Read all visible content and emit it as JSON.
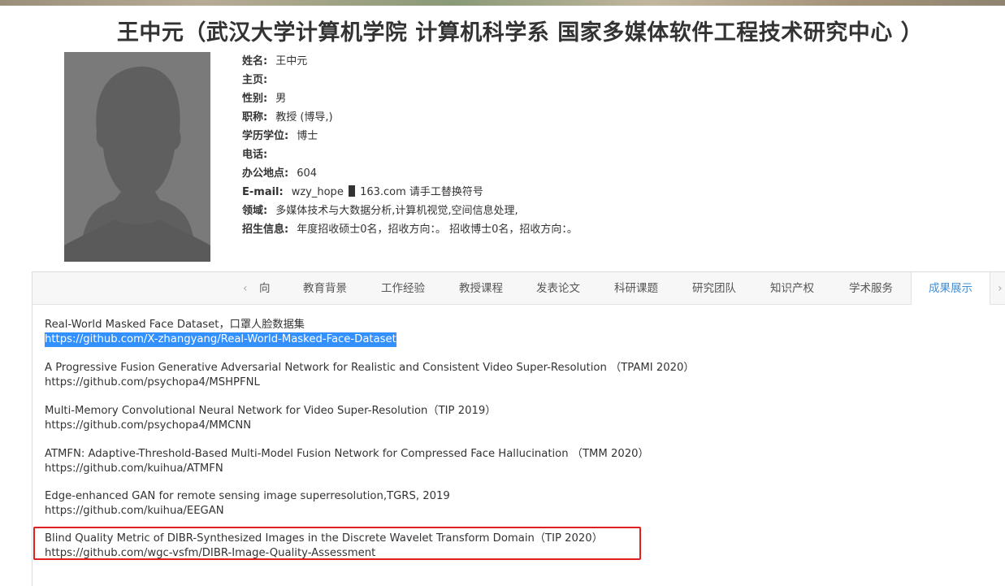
{
  "page": {
    "title": "王中元（武汉大学计算机学院 计算机科学系 国家多媒体软件工程技术研究中心 ）"
  },
  "profile": {
    "rows": [
      {
        "label": "姓名:",
        "value": "王中元"
      },
      {
        "label": "主页:",
        "value": ""
      },
      {
        "label": "性别:",
        "value": "男"
      },
      {
        "label": "职称:",
        "value": "教授 (博导,)"
      },
      {
        "label": "学历学位:",
        "value": "博士"
      },
      {
        "label": "电话:",
        "value": ""
      },
      {
        "label": "办公地点:",
        "value": "604"
      },
      {
        "label": "E-mail:",
        "value_before": "wzy_hope",
        "value_after": "163.com 请手工替换符号"
      },
      {
        "label": "领域:",
        "value": "多媒体技术与大数据分析,计算机视觉,空间信息处理,"
      },
      {
        "label": "招生信息:",
        "value": "年度招收硕士0名，招收方向：。 招收博士0名，招收方向：。"
      }
    ]
  },
  "tabs": {
    "prev_arrow": "‹",
    "items": [
      {
        "label": "向"
      },
      {
        "label": "教育背景"
      },
      {
        "label": "工作经验"
      },
      {
        "label": "教授课程"
      },
      {
        "label": "发表论文"
      },
      {
        "label": "科研课题"
      },
      {
        "label": "研究团队"
      },
      {
        "label": "知识产权"
      },
      {
        "label": "学术服务"
      },
      {
        "label": "成果展示"
      }
    ],
    "active": "成果展示",
    "next_arrow": "›"
  },
  "entries": [
    {
      "title": "Real-World Masked Face Dataset，口罩人脸数据集",
      "url": "https://github.com/X-zhangyang/Real-World-Masked-Face-Dataset",
      "selected": true
    },
    {
      "title": "A Progressive Fusion Generative Adversarial Network for Realistic and Consistent Video Super-Resolution （TPAMI 2020）",
      "url": "https://github.com/psychopa4/MSHPFNL"
    },
    {
      "title": "Multi-Memory Convolutional Neural Network for Video Super-Resolution（TIP 2019）",
      "url": "https://github.com/psychopa4/MMCNN"
    },
    {
      "title": "ATMFN: Adaptive-Threshold-Based Multi-Model Fusion Network for Compressed Face Hallucination （TMM 2020）",
      "url": "https://github.com/kuihua/ATMFN"
    },
    {
      "title": "Edge-enhanced GAN for remote sensing image superresolution,TGRS, 2019",
      "url": "https://github.com/kuihua/EEGAN"
    },
    {
      "title": "Blind Quality Metric of DIBR-Synthesized Images in the Discrete Wavelet Transform Domain（TIP 2020）",
      "url": "https://github.com/wgc-vsfm/DIBR-Image-Quality-Assessment",
      "highlighted": true
    }
  ],
  "colors": {
    "active_tab": "#3d8fd8",
    "selection": "#3390ff",
    "highlight_border": "#e02020"
  },
  "icons": {
    "avatar": "person-silhouette-icon",
    "prev": "chevron-left-icon",
    "next": "chevron-right-icon",
    "email_at": "redacted-at-symbol"
  }
}
